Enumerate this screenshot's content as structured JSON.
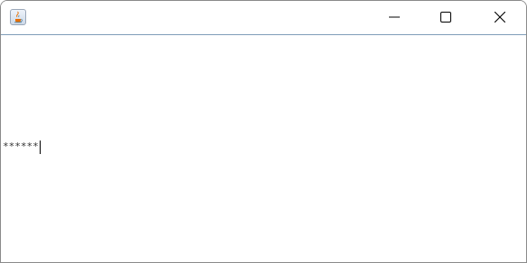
{
  "window": {
    "title": "",
    "icon": "java-cup-icon",
    "controls": {
      "minimize_icon": "minimize-icon",
      "maximize_icon": "maximize-icon",
      "close_icon": "close-icon"
    }
  },
  "password_field": {
    "masked_value": "******"
  }
}
